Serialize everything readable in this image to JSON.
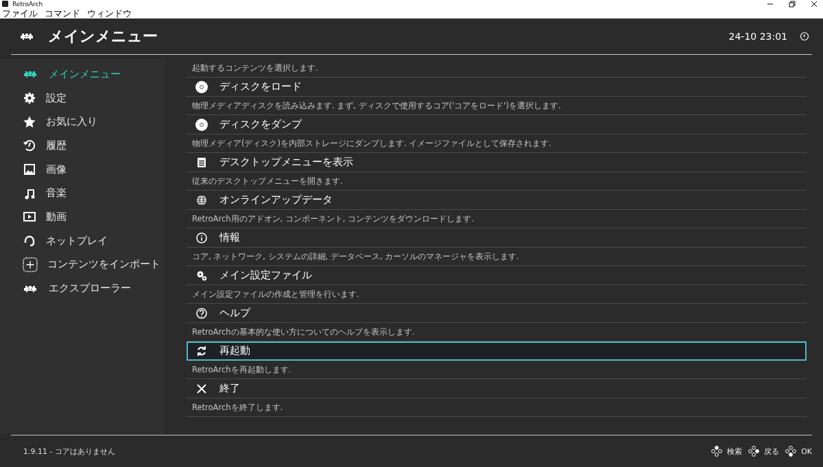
{
  "window": {
    "title": "RetroArch"
  },
  "menu_bar": [
    "ファイル",
    "コマンド",
    "ウィンドウ"
  ],
  "header": {
    "title": "メインメニュー",
    "clock": "24-10 23:01"
  },
  "sidebar": {
    "items": [
      {
        "label": "メインメニュー",
        "kind": "invader",
        "selected": true
      },
      {
        "label": "設定",
        "kind": "gear",
        "selected": false
      },
      {
        "label": "お気に入り",
        "kind": "star",
        "selected": false
      },
      {
        "label": "履歴",
        "kind": "history",
        "selected": false
      },
      {
        "label": "画像",
        "kind": "image",
        "selected": false
      },
      {
        "label": "音楽",
        "kind": "music",
        "selected": false
      },
      {
        "label": "動画",
        "kind": "video",
        "selected": false
      },
      {
        "label": "ネットプレイ",
        "kind": "netplay",
        "selected": false
      },
      {
        "label": "コンテンツをインポート",
        "kind": "add",
        "selected": false
      },
      {
        "label": "エクスプローラー",
        "kind": "invader",
        "selected": false
      }
    ]
  },
  "menu": {
    "top_description": "起動するコンテンツを選択します.",
    "items": [
      {
        "label": "ディスクをロード",
        "kind": "disc",
        "description": "物理メディアディスクを読み込みます. まず, ディスクで使用するコア('コアをロード')を選択します.",
        "selected": false
      },
      {
        "label": "ディスクをダンプ",
        "kind": "disc",
        "description": "物理メディア(ディスク)を内部ストレージにダンプします. イメージファイルとして保存されます.",
        "selected": false
      },
      {
        "label": "デスクトップメニューを表示",
        "kind": "list",
        "description": "従来のデスクトップメニューを開きます.",
        "selected": false
      },
      {
        "label": "オンラインアップデータ",
        "kind": "globe",
        "description": "RetroArch用のアドオン, コンポーネント, コンテンツをダウンロードします.",
        "selected": false
      },
      {
        "label": "情報",
        "kind": "info",
        "description": "コア, ネットワーク, システムの詳細, データベース, カーソルのマネージャを表示します.",
        "selected": false
      },
      {
        "label": "メイン設定ファイル",
        "kind": "gears",
        "description": "メイン設定ファイルの作成と管理を行います.",
        "selected": false
      },
      {
        "label": "ヘルプ",
        "kind": "help",
        "description": "RetroArchの基本的な使い方についてのヘルプを表示します.",
        "selected": false
      },
      {
        "label": "再起動",
        "kind": "restart",
        "description": "RetroArchを再起動します.",
        "selected": true
      },
      {
        "label": "終了",
        "kind": "close",
        "description": "RetroArchを終了します.",
        "selected": false
      }
    ]
  },
  "footer": {
    "status": "1.9.11 - コアはありません",
    "buttons": [
      {
        "label": "検索",
        "kind": "pad-top"
      },
      {
        "label": "戻る",
        "kind": "pad-right"
      },
      {
        "label": "OK",
        "kind": "pad-bottom"
      }
    ]
  }
}
